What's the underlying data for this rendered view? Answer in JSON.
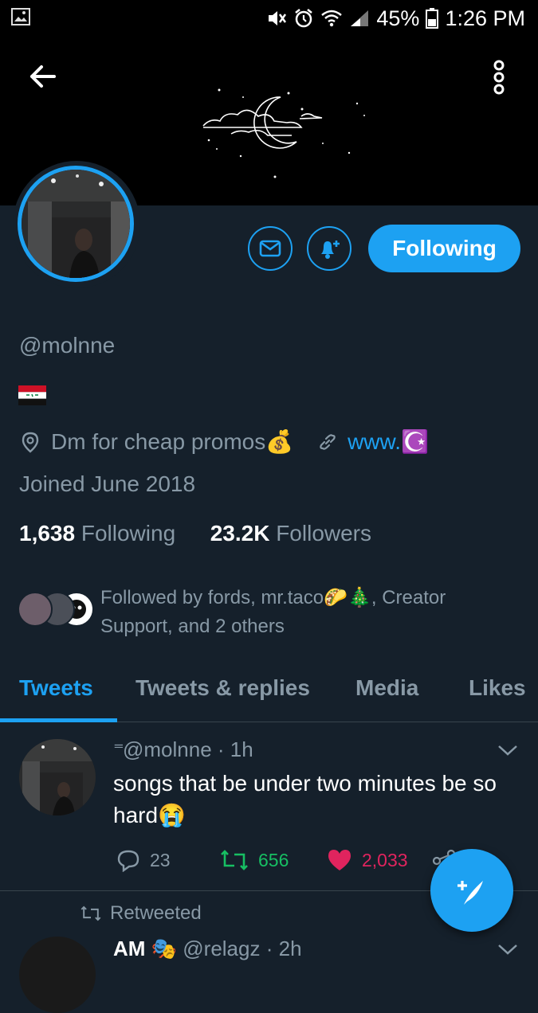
{
  "status_bar": {
    "battery": "45%",
    "time": "1:26 PM"
  },
  "profile": {
    "handle": "@molnne",
    "bio_flag": "🇮🇶",
    "location": "Dm for cheap promos💰",
    "website": "www.☪️",
    "joined": "Joined June 2018",
    "following_count": "1,638",
    "following_label": "Following",
    "followers_count": "23.2K",
    "followers_label": "Followers",
    "followed_by": "Followed by fords, mr.taco🌮🎄, Creator Support, and 2 others",
    "follow_button": "Following"
  },
  "tabs": [
    "Tweets",
    "Tweets & replies",
    "Media",
    "Likes"
  ],
  "tweet": {
    "pin_icon": "pin-icon",
    "handle": "@molnne",
    "time": "1h",
    "text": "songs that be under two minutes be so hard😭",
    "replies": "23",
    "retweets": "656",
    "likes": "2,033"
  },
  "retweet_item": {
    "label": "Retweeted",
    "name": "AM 🎭",
    "handle": "@relagz",
    "time": "2h"
  },
  "colors": {
    "accent": "#1da1f2",
    "background": "#15202b",
    "retweet": "#17bf63",
    "like": "#e0245e"
  }
}
